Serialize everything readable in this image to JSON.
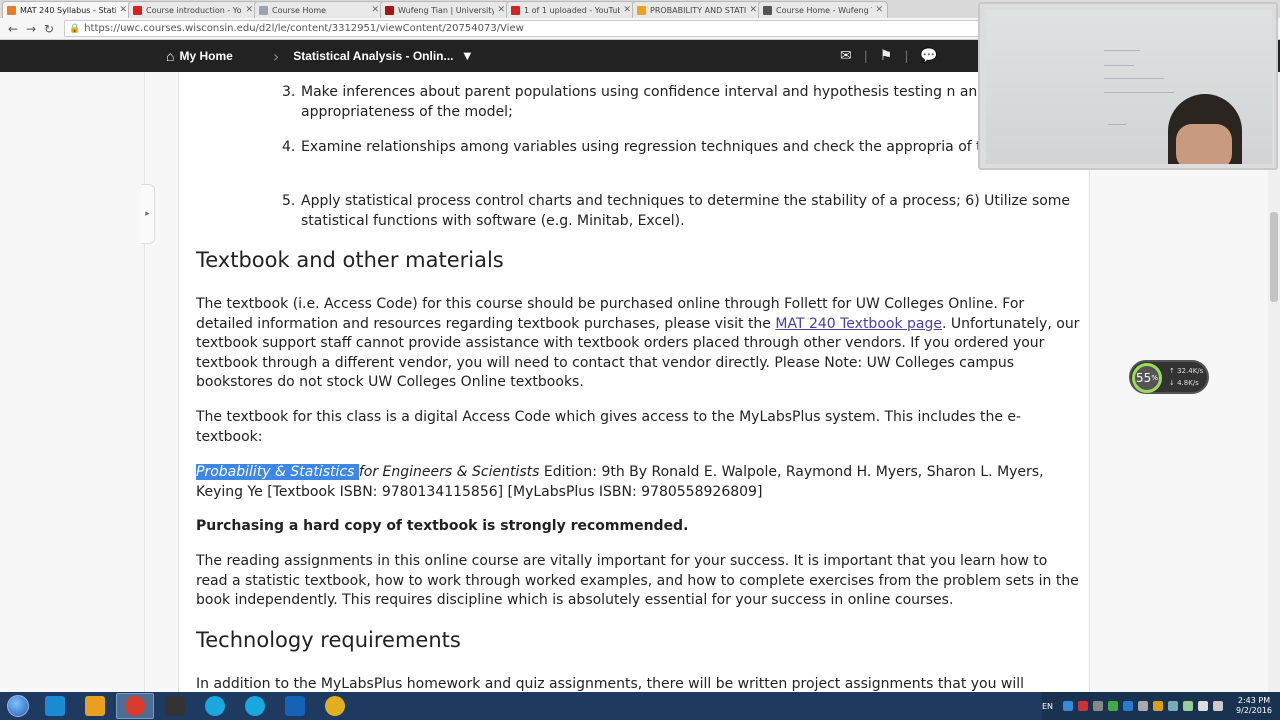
{
  "tabs": [
    {
      "title": "MAT 240 Syllabus - Static",
      "active": true,
      "color": "#e87c2a"
    },
    {
      "title": "Course introduction - You",
      "active": false,
      "color": "#d62222"
    },
    {
      "title": "Course Home",
      "active": false,
      "color": "#9aa4b1"
    },
    {
      "title": "Wufeng Tian | University",
      "active": false,
      "color": "#a01818"
    },
    {
      "title": "1 of 1 uploaded - YouTub",
      "active": false,
      "color": "#d62222"
    },
    {
      "title": "PROBABILITY AND STATIS",
      "active": false,
      "color": "#f0a020"
    },
    {
      "title": "Course Home - Wufeng T",
      "active": false,
      "color": "#555"
    }
  ],
  "address": {
    "url": "https://uwc.courses.wisconsin.edu/d2l/le/content/3312951/viewContent/20754073/View"
  },
  "navbar": {
    "home": "My Home",
    "course": "Statistical Analysis - Onlin..."
  },
  "objectives": [
    {
      "num": "3.",
      "text": "Make inferences about parent populations using confidence interval and hypothesis testing n and check the appropriateness of the model;"
    },
    {
      "num": "4.",
      "text": "Examine relationships among variables using regression techniques and check the appropria of the models;"
    },
    {
      "num": "5.",
      "text": "Apply statistical process control charts and techniques to determine the stability of a process; 6) Utilize some statistical functions with software (e.g. Minitab, Excel)."
    }
  ],
  "textbook": {
    "heading": "Textbook and other materials",
    "p1_pre": "The textbook (i.e. Access Code) for this course should be purchased online through Follett for UW Colleges Online. For detailed information and resources regarding textbook purchases, please visit the ",
    "p1_link": "MAT 240 Textbook page",
    "p1_post": ". Unfortunately, our textbook support staff cannot provide assistance with textbook orders placed through other vendors. If you ordered your textbook through a different vendor, you will need to contact that vendor directly. Please Note: UW Colleges campus bookstores do not stock UW Colleges Online textbooks.",
    "p2": "The textbook for this class is a digital Access Code which gives access to the MyLabsPlus system. This includes the e-textbook:",
    "book_highlight": "Probability & Statistics ",
    "book_italic": "for Engineers & Scientists",
    "book_rest": " Edition: 9th By Ronald E. Walpole, Raymond H. Myers, Sharon L. Myers, Keying Ye [Textbook ISBN: 9780134115856] [MyLabsPlus ISBN: 9780558926809]",
    "bold_line": "Purchasing a hard copy of textbook is strongly recommended.",
    "p3": "The reading assignments in this online course are vitally important for your success. It is important that you learn how to read a statistic textbook, how to work through worked examples, and how to complete exercises from the problem sets in the book independently. This requires discipline which is absolutely essential for your success in online courses."
  },
  "technology": {
    "heading": "Technology requirements",
    "p1": "In addition to the MyLabsPlus homework and quiz assignments, there will be written project assignments that you will"
  },
  "net_widget": {
    "percent": "55",
    "up": "32.4",
    "down": "4.8"
  },
  "system": {
    "lang": "EN",
    "time": "2:43 PM",
    "date": "9/2/2016"
  },
  "taskbar_colors": [
    "#1a8ad4",
    "#e8a020",
    "#d63b2b",
    "#333",
    "#1aa7e0",
    "#1aa7e0",
    "#1463b8",
    "#e0b020"
  ]
}
